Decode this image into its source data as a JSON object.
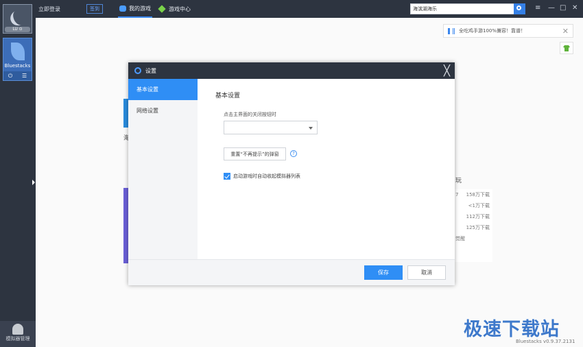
{
  "sidebar": {
    "avatar_badge": "LU ⊙",
    "app_tile": {
      "label": "Bluestacks"
    },
    "bottom_label": "模拟器管理"
  },
  "topbar": {
    "login": "立即登录",
    "signin": "签到",
    "tabs": [
      {
        "label": "我的游戏",
        "icon": "gamepad-icon",
        "active": true
      },
      {
        "label": "游戏中心",
        "icon": "cube-icon",
        "active": false
      }
    ],
    "search_value": "海滨湖海乐",
    "window_controls": [
      "≡",
      "—",
      "□",
      "✕"
    ]
  },
  "notice": {
    "text": "全吃鸡手游100%兼容！靠谱！",
    "close": "✕"
  },
  "background": {
    "partial_labels": [
      "海",
      "玩",
      "7",
      "觉醒"
    ],
    "downloads": [
      "158万下载",
      "<1万下载",
      "112万下载",
      "125万下载"
    ]
  },
  "dialog": {
    "title": "设置",
    "close": "╳",
    "nav": [
      {
        "label": "基本设置",
        "active": true
      },
      {
        "label": "网络设置",
        "active": false
      }
    ],
    "section_title": "基本设置",
    "close_action_label": "点击主界面的关闭按钮时",
    "close_action_selected": "",
    "reset_button": "重置“不再提示”的弹窗",
    "help": "?",
    "auto_collapse_label": "启动游戏时自动收起模拟器列表",
    "auto_collapse_checked": true,
    "save": "保存",
    "cancel": "取消"
  },
  "branding": {
    "watermark": "极速下载站",
    "version": "Bluestacks v0.9.37.2131"
  },
  "colors": {
    "chrome_dark": "#2d3440",
    "accent": "#2f8ef5"
  }
}
